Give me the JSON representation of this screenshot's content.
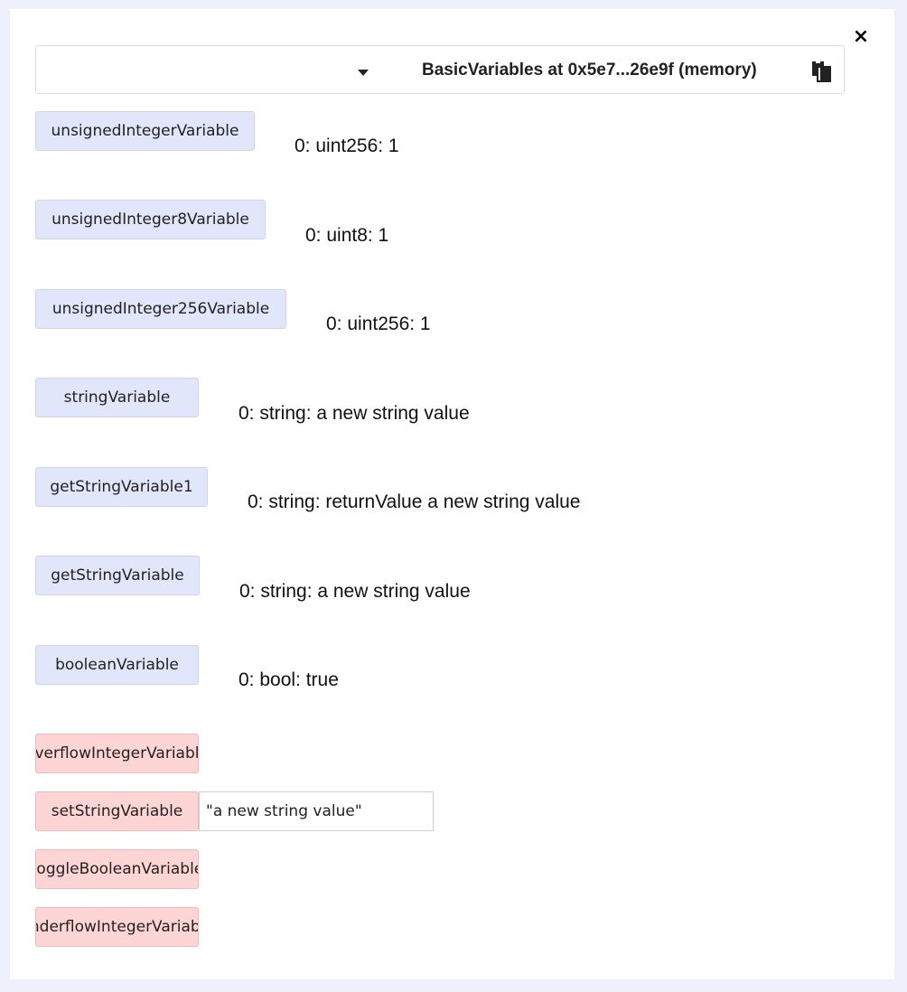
{
  "header": {
    "contract_title": "BasicVariables at 0x5e7...26e9f (memory)",
    "close_icon": "×"
  },
  "functions": [
    {
      "label": "unsignedIntegerVariable",
      "output": "0: uint256: 1"
    },
    {
      "label": "unsignedInteger8Variable",
      "output": "0: uint8: 1"
    },
    {
      "label": "unsignedInteger256Variable",
      "output": "0: uint256: 1"
    },
    {
      "label": "stringVariable",
      "output": "0: string: a new string value"
    },
    {
      "label": "getStringVariable1",
      "output": "0: string: returnValue a new string value"
    },
    {
      "label": "getStringVariable",
      "output": "0: string: a new string value"
    },
    {
      "label": "booleanVariable",
      "output": "0: bool: true"
    },
    {
      "label": "overflowIntegerVariable"
    },
    {
      "label": "setStringVariable",
      "input_value": "\"a new string value\""
    },
    {
      "label": "toggleBooleanVariable"
    },
    {
      "label": "underflowIntegerVariable"
    }
  ],
  "colors": {
    "call_button": "#e1e6fa",
    "transact_button": "#fdd5d5",
    "background": "#eef0fc"
  },
  "icons": {
    "close": "close-icon",
    "dropdown": "chevron-down-icon",
    "copy": "copy-icon"
  }
}
